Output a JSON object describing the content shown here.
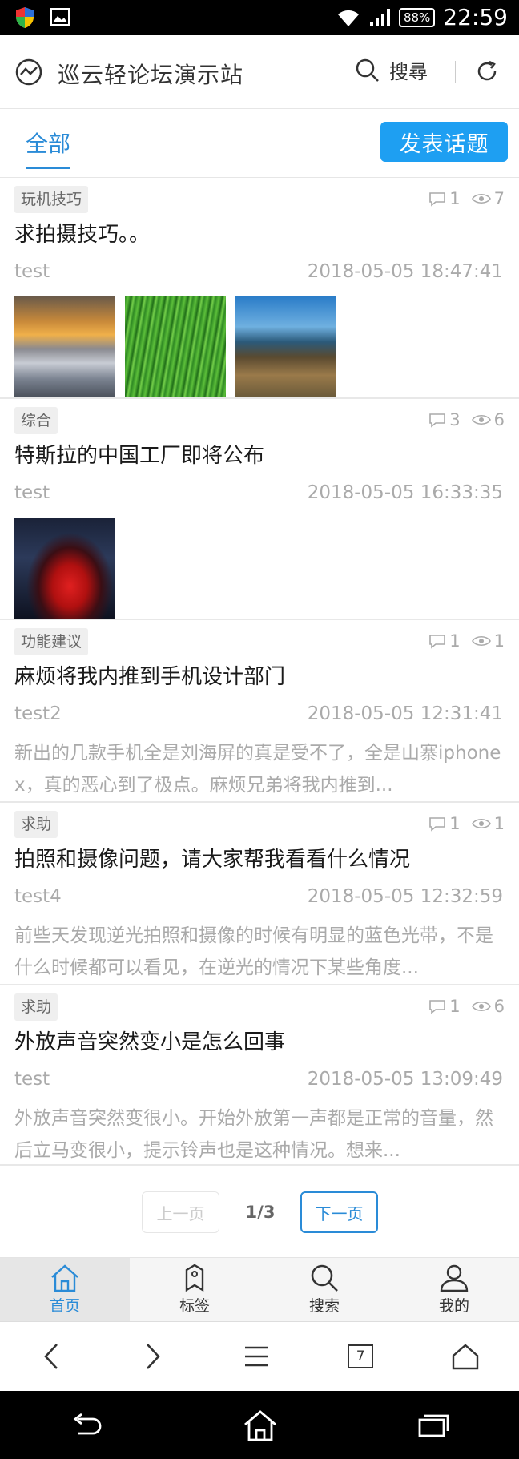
{
  "status_bar": {
    "battery": "88%",
    "time": "22:59"
  },
  "app": {
    "title": "巡云轻论坛演示站",
    "search_label": "搜尋"
  },
  "tabs": {
    "active_label": "全部",
    "post_button": "发表话题"
  },
  "posts": [
    {
      "tag": "玩机技巧",
      "comments": "1",
      "views": "7",
      "title": "求拍摄技巧。。",
      "author": "test",
      "date": "2018-05-05 18:47:41",
      "excerpt": "",
      "images": [
        "sunset-fog",
        "grass",
        "rocky-shore"
      ]
    },
    {
      "tag": "综合",
      "comments": "3",
      "views": "6",
      "title": "特斯拉的中国工厂即将公布",
      "author": "test",
      "date": "2018-05-05 16:33:35",
      "excerpt": "",
      "images": [
        "red-car"
      ]
    },
    {
      "tag": "功能建议",
      "comments": "1",
      "views": "1",
      "title": "麻烦将我内推到手机设计部门",
      "author": "test2",
      "date": "2018-05-05 12:31:41",
      "excerpt": "新出的几款手机全是刘海屏的真是受不了，全是山寨iphone x，真的恶心到了极点。麻烦兄弟将我内推到...",
      "images": []
    },
    {
      "tag": "求助",
      "comments": "1",
      "views": "1",
      "title": "拍照和摄像问题，请大家帮我看看什么情况",
      "author": "test4",
      "date": "2018-05-05 12:32:59",
      "excerpt": "前些天发现逆光拍照和摄像的时候有明显的蓝色光带，不是什么时候都可以看见，在逆光的情况下某些角度...",
      "images": []
    },
    {
      "tag": "求助",
      "comments": "1",
      "views": "6",
      "title": "外放声音突然变小是怎么回事",
      "author": "test",
      "date": "2018-05-05 13:09:49",
      "excerpt": "外放声音突然变很小。开始外放第一声都是正常的音量，然后立马变很小，提示铃声也是这种情况。想来...",
      "images": []
    }
  ],
  "pager": {
    "prev": "上一页",
    "current": "1/3",
    "next": "下一页"
  },
  "bottom_nav": [
    {
      "label": "首页",
      "icon": "home-icon",
      "active": true
    },
    {
      "label": "标签",
      "icon": "tag-icon",
      "active": false
    },
    {
      "label": "搜索",
      "icon": "search-icon",
      "active": false
    },
    {
      "label": "我的",
      "icon": "user-icon",
      "active": false
    }
  ],
  "browser": {
    "tab_count": "7"
  },
  "colors": {
    "accent": "#1e9ff2",
    "link": "#2a8bd7",
    "muted": "#aaaaaa"
  }
}
